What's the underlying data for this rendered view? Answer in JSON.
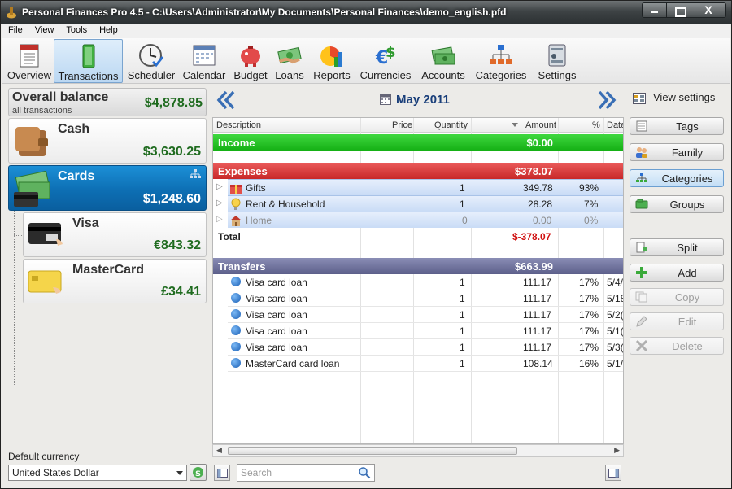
{
  "window": {
    "title": "Personal Finances Pro 4.5 - C:\\Users\\Administrator\\My Documents\\Personal Finances\\demo_english.pfd",
    "close_glyph": "X"
  },
  "menu": [
    "File",
    "View",
    "Tools",
    "Help"
  ],
  "toolbar": [
    {
      "label": "Overview",
      "icon": "overview-icon"
    },
    {
      "label": "Transactions",
      "icon": "transactions-icon",
      "active": true
    },
    {
      "label": "Scheduler",
      "icon": "scheduler-icon"
    },
    {
      "label": "Calendar",
      "icon": "calendar-icon"
    },
    {
      "label": "Budget",
      "icon": "budget-icon"
    },
    {
      "label": "Loans",
      "icon": "loans-icon"
    },
    {
      "label": "Reports",
      "icon": "reports-icon"
    },
    {
      "label": "Currencies",
      "icon": "currencies-icon"
    },
    {
      "label": "Accounts",
      "icon": "accounts-icon"
    },
    {
      "label": "Categories",
      "icon": "categories-icon"
    },
    {
      "label": "Settings",
      "icon": "settings-icon"
    }
  ],
  "left": {
    "overall": {
      "title": "Overall balance",
      "subtitle": "all transactions",
      "value": "$4,878.85"
    },
    "accounts": [
      {
        "name": "Cash",
        "value": "$3,630.25"
      },
      {
        "name": "Cards",
        "value": "$1,248.60",
        "selected": true
      },
      {
        "name": "Visa",
        "value": "€843.32"
      },
      {
        "name": "MasterCard",
        "value": "£34.41"
      }
    ],
    "default_currency_label": "Default currency",
    "default_currency_value": "United States Dollar"
  },
  "main": {
    "month": "May 2011",
    "columns": {
      "description": "Description",
      "price": "Price",
      "quantity": "Quantity",
      "amount": "Amount",
      "percent": "%",
      "date": "Date"
    },
    "income": {
      "label": "Income",
      "total": "$0.00"
    },
    "expenses": {
      "label": "Expenses",
      "total": "$378.07",
      "rows": [
        {
          "name": "Gifts",
          "quantity": "1",
          "amount": "349.78",
          "percent": "93%"
        },
        {
          "name": "Rent & Household",
          "quantity": "1",
          "amount": "28.28",
          "percent": "7%"
        },
        {
          "name": "Home",
          "quantity": "0",
          "amount": "0.00",
          "percent": "0%"
        }
      ],
      "total_label": "Total",
      "total_value": "$-378.07"
    },
    "transfers": {
      "label": "Transfers",
      "total": "$663.99",
      "rows": [
        {
          "name": "Visa card loan",
          "quantity": "1",
          "amount": "111.17",
          "percent": "17%",
          "date": "5/4/"
        },
        {
          "name": "Visa card loan",
          "quantity": "1",
          "amount": "111.17",
          "percent": "17%",
          "date": "5/18"
        },
        {
          "name": "Visa card loan",
          "quantity": "1",
          "amount": "111.17",
          "percent": "17%",
          "date": "5/2("
        },
        {
          "name": "Visa card loan",
          "quantity": "1",
          "amount": "111.17",
          "percent": "17%",
          "date": "5/1("
        },
        {
          "name": "Visa card loan",
          "quantity": "1",
          "amount": "111.17",
          "percent": "17%",
          "date": "5/3("
        },
        {
          "name": "MasterCard card loan",
          "quantity": "1",
          "amount": "108.14",
          "percent": "16%",
          "date": "5/1/"
        }
      ]
    },
    "search_placeholder": "Search"
  },
  "right": {
    "view_settings": "View settings",
    "views": [
      "Tags",
      "Family",
      "Categories",
      "Groups"
    ],
    "selected_view": "Categories",
    "actions": [
      {
        "label": "Split",
        "enabled": true
      },
      {
        "label": "Add",
        "enabled": true
      },
      {
        "label": "Copy",
        "enabled": false
      },
      {
        "label": "Edit",
        "enabled": false
      },
      {
        "label": "Delete",
        "enabled": false
      }
    ]
  },
  "colors": {
    "income": "#1fbf1f",
    "expenses": "#d63a3a",
    "transfers": "#6a6d9a",
    "selected": "#0d6fb4",
    "positive": "#1f6b1f",
    "negative": "#d01010"
  }
}
